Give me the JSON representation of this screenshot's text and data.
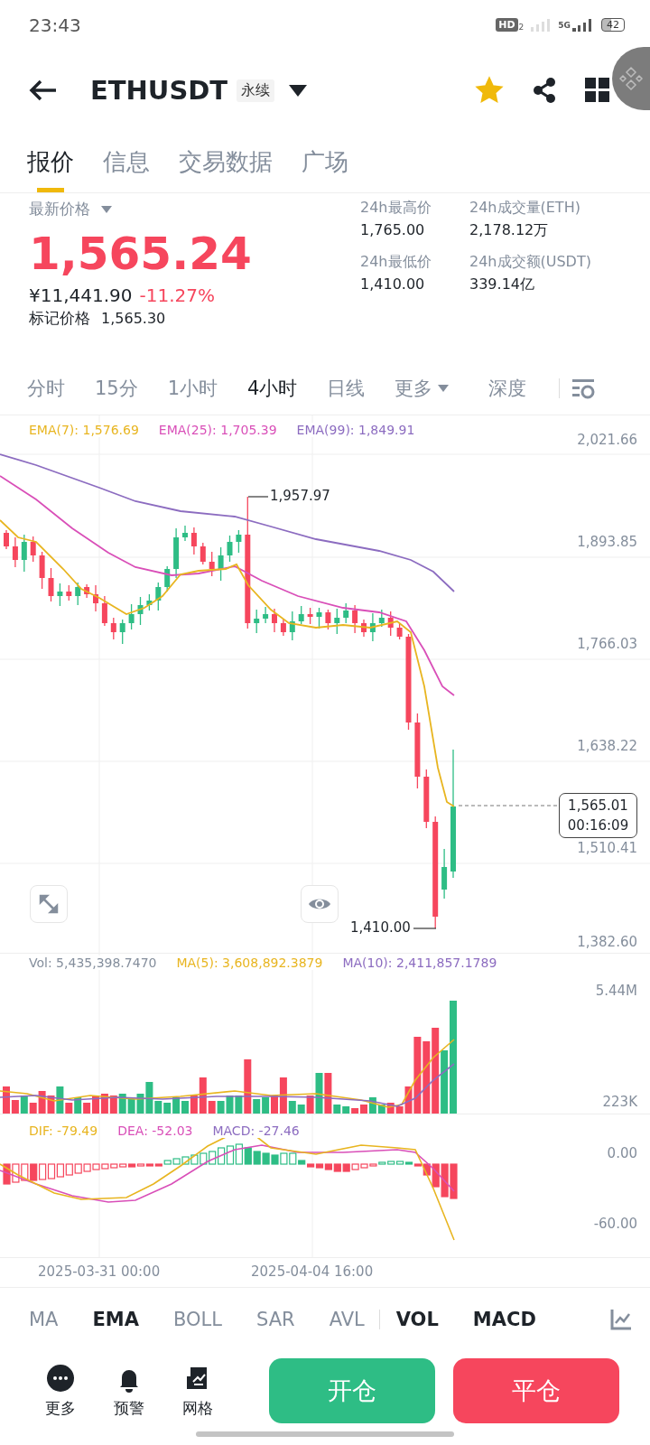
{
  "status_bar": {
    "time": "23:43",
    "hd": "HD",
    "sim": "2",
    "network": "5G",
    "battery": "42"
  },
  "header": {
    "symbol": "ETHUSDT",
    "badge": "永续",
    "favorite": true
  },
  "tabs": [
    {
      "label": "报价",
      "selected": true
    },
    {
      "label": "信息",
      "selected": false
    },
    {
      "label": "交易数据",
      "selected": false
    },
    {
      "label": "广场",
      "selected": false
    }
  ],
  "price": {
    "label": "最新价格",
    "last": "1,565.24",
    "fiat": "¥11,441.90",
    "change": "-11.27%",
    "mark_label": "标记价格",
    "mark": "1,565.30"
  },
  "stats": [
    {
      "label": "24h最高价",
      "value": "1,765.00"
    },
    {
      "label": "24h成交量(ETH)",
      "value": "2,178.12万"
    },
    {
      "label": "24h最低价",
      "value": "1,410.00"
    },
    {
      "label": "24h成交额(USDT)",
      "value": "339.14亿"
    }
  ],
  "intervals": [
    {
      "label": "分时",
      "selected": false
    },
    {
      "label": "15分",
      "selected": false
    },
    {
      "label": "1小时",
      "selected": false
    },
    {
      "label": "4小时",
      "selected": true
    },
    {
      "label": "日线",
      "selected": false
    }
  ],
  "more_label": "更多",
  "depth_label": "深度",
  "chart": {
    "legend": [
      {
        "text": "EMA(7): 1,576.69",
        "color": "#e8b520"
      },
      {
        "text": "EMA(25): 1,705.39",
        "color": "#d94fb8"
      },
      {
        "text": "EMA(99): 1,849.91",
        "color": "#8c6cc0"
      }
    ],
    "price_ticks": [
      "2,021.66",
      "1,893.85",
      "1,766.03",
      "1,638.22",
      "1,510.41",
      "1,382.60"
    ],
    "high_label": "1,957.97",
    "low_label": "1,410.00",
    "current": {
      "price": "1,565.01",
      "countdown": "00:16:09"
    }
  },
  "volume": {
    "legend": [
      {
        "text": "Vol: 5,435,398.7470",
        "color": "#848e9c"
      },
      {
        "text": "MA(5): 3,608,892.3879",
        "color": "#e8b520"
      },
      {
        "text": "MA(10): 2,411,857.1789",
        "color": "#8c6cc0"
      }
    ],
    "ticks": [
      "5.44M",
      "223K"
    ]
  },
  "macd": {
    "legend": [
      {
        "text": "DIF: -79.49",
        "color": "#e8b520"
      },
      {
        "text": "DEA: -52.03",
        "color": "#d94fb8"
      },
      {
        "text": "MACD: -27.46",
        "color": "#8c6cc0"
      }
    ],
    "ticks": [
      "0.00",
      "-60.00"
    ]
  },
  "time_axis": [
    "2025-03-31 00:00",
    "2025-04-04 16:00"
  ],
  "main_indicators": [
    {
      "label": "MA",
      "selected": false
    },
    {
      "label": "EMA",
      "selected": true
    },
    {
      "label": "BOLL",
      "selected": false
    },
    {
      "label": "SAR",
      "selected": false
    },
    {
      "label": "AVL",
      "selected": false
    }
  ],
  "sub_indicators": [
    {
      "label": "VOL",
      "selected": true
    },
    {
      "label": "MACD",
      "selected": true
    }
  ],
  "actions": [
    {
      "label": "更多",
      "kind": "more"
    },
    {
      "label": "预警",
      "kind": "alert"
    },
    {
      "label": "网格",
      "kind": "grid"
    }
  ],
  "trade_buttons": [
    {
      "label": "开仓",
      "kind": "open"
    },
    {
      "label": "平仓",
      "kind": "close"
    }
  ]
}
